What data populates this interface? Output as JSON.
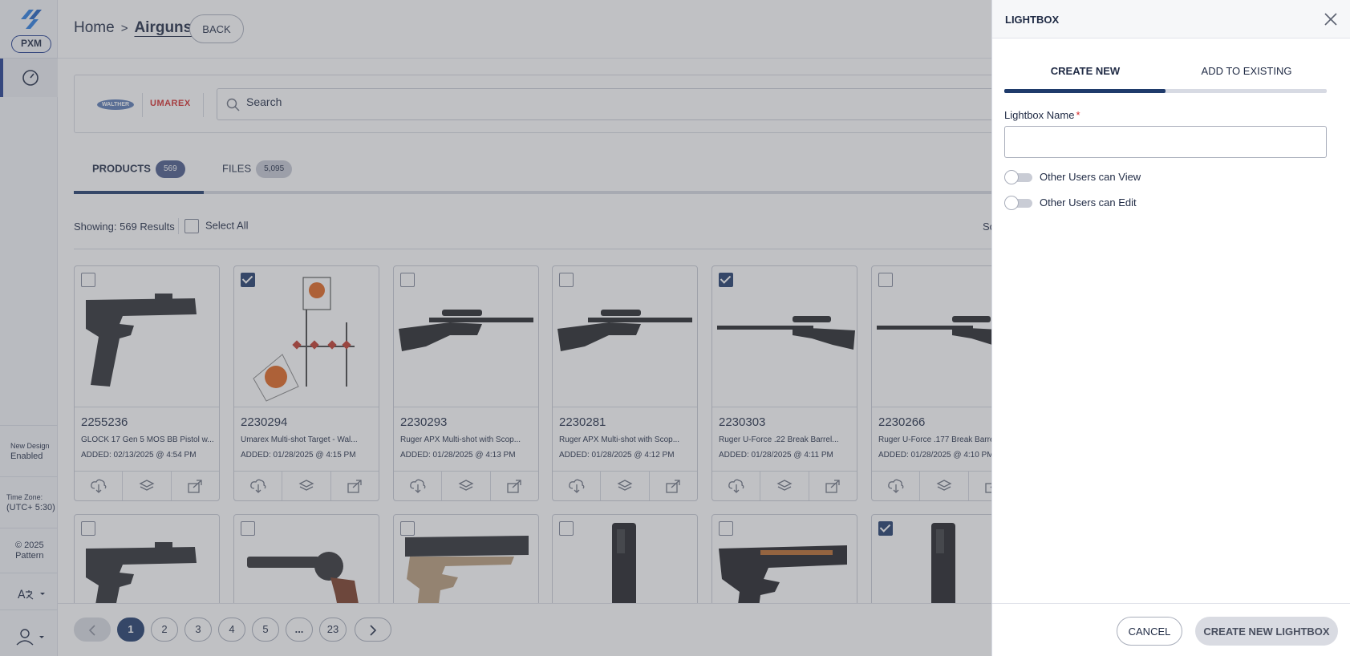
{
  "app": {
    "logo_text": "PXM"
  },
  "sidebar": {
    "new_design_label": "New Design",
    "new_design_value": "Enabled",
    "timezone_label": "Time Zone:",
    "timezone_value": "(UTC+ 5:30)",
    "copyright": "© 2025",
    "company": "Pattern"
  },
  "breadcrumb": {
    "home": "Home",
    "separator": ">",
    "current": "Airguns"
  },
  "back_label": "BACK",
  "brands": {
    "walther": "WALTHER",
    "umarex": "UMAREX"
  },
  "search": {
    "placeholder": "Search",
    "value": ""
  },
  "tabs": [
    {
      "label": "PRODUCTS",
      "count": "569",
      "active": true
    },
    {
      "label": "FILES",
      "count": "5,095",
      "active": false
    }
  ],
  "results": {
    "showing": "Showing: 569 Results",
    "select_all": "Select All",
    "sort_fragment": "So"
  },
  "products": [
    {
      "sku": "2255236",
      "desc": "GLOCK 17 Gen 5 MOS BB Pistol w...",
      "added": "ADDED: 02/13/2025 @ 4:54 PM",
      "checked": false,
      "image": "pistol"
    },
    {
      "sku": "2230294",
      "desc": "Umarex Multi-shot Target - Wal...",
      "added": "ADDED: 01/28/2025 @ 4:15 PM",
      "checked": true,
      "image": "target"
    },
    {
      "sku": "2230293",
      "desc": "Ruger APX Multi-shot with Scop...",
      "added": "ADDED: 01/28/2025 @ 4:13 PM",
      "checked": false,
      "image": "rifle"
    },
    {
      "sku": "2230281",
      "desc": "Ruger APX Multi-shot with Scop...",
      "added": "ADDED: 01/28/2025 @ 4:12 PM",
      "checked": false,
      "image": "rifle"
    },
    {
      "sku": "2230303",
      "desc": "Ruger U-Force .22 Break Barrel...",
      "added": "ADDED: 01/28/2025 @ 4:11 PM",
      "checked": true,
      "image": "rifle-long"
    },
    {
      "sku": "2230266",
      "desc": "Ruger U-Force .177 Break Barre...",
      "added": "ADDED: 01/28/2025 @ 4:10 PM",
      "checked": false,
      "image": "rifle-long"
    }
  ],
  "products_row2": [
    {
      "checked": false,
      "image": "pistol"
    },
    {
      "checked": false,
      "image": "revolver"
    },
    {
      "checked": false,
      "image": "pistol-tan"
    },
    {
      "checked": false,
      "image": "magazine"
    },
    {
      "checked": false,
      "image": "pistol-1911"
    },
    {
      "checked": true,
      "image": "magazine"
    }
  ],
  "pagination": {
    "pages": [
      "1",
      "2",
      "3",
      "4",
      "5",
      "...",
      "23"
    ],
    "current": "1"
  },
  "lightbox": {
    "title": "LIGHTBOX",
    "tab_create": "CREATE NEW",
    "tab_existing": "ADD TO EXISTING",
    "name_label": "Lightbox Name",
    "required_mark": "*",
    "name_value": "",
    "toggle_view": "Other Users can View",
    "toggle_edit": "Other Users can Edit",
    "cancel": "CANCEL",
    "create": "CREATE NEW LIGHTBOX"
  },
  "colors": {
    "primary": "#1f3b6b",
    "brand_red": "#d42a2a",
    "overlay": "#5a5c64"
  },
  "icons": [
    "pxm-logo-icon",
    "dashboard-icon",
    "language-icon",
    "user-icon",
    "search-icon",
    "download-icon",
    "layers-icon",
    "share-icon",
    "close-icon",
    "chevron-left-icon",
    "chevron-right-icon"
  ]
}
